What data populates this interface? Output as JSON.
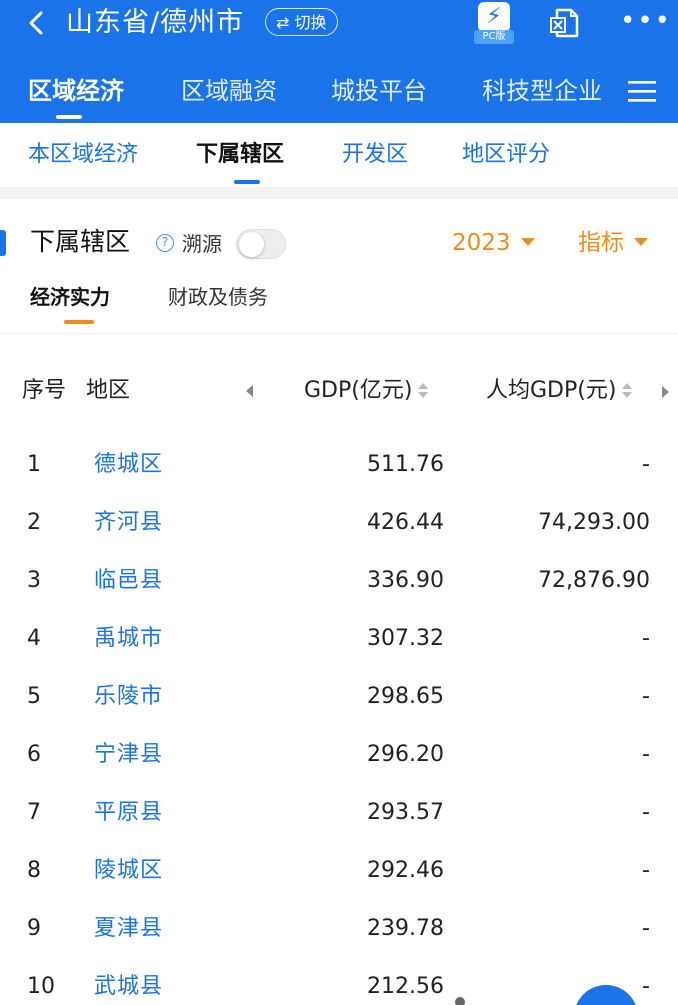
{
  "header": {
    "city": "山东省/德州市",
    "switch_label": "⇄ 切换",
    "pc_label": "PC版",
    "more_label": "•••"
  },
  "main_tabs": [
    "区域经济",
    "区域融资",
    "城投平台",
    "科技型企业"
  ],
  "sub_tabs": [
    "本区域经济",
    "下属辖区",
    "开发区",
    "地区评分"
  ],
  "section": {
    "title": "下属辖区",
    "trace_label": "溯源",
    "trace_enabled": false,
    "year": "2023",
    "metric_label": "指标"
  },
  "category_tabs": [
    "经济实力",
    "财政及债务"
  ],
  "table": {
    "headers": {
      "index": "序号",
      "region": "地区",
      "gdp": "GDP(亿元)",
      "per_capita": "人均GDP(元)"
    },
    "rows": [
      {
        "index": "1",
        "name": "德城区",
        "gdp": "511.76",
        "per_capita": "-"
      },
      {
        "index": "2",
        "name": "齐河县",
        "gdp": "426.44",
        "per_capita": "74,293.00"
      },
      {
        "index": "3",
        "name": "临邑县",
        "gdp": "336.90",
        "per_capita": "72,876.90"
      },
      {
        "index": "4",
        "name": "禹城市",
        "gdp": "307.32",
        "per_capita": "-"
      },
      {
        "index": "5",
        "name": "乐陵市",
        "gdp": "298.65",
        "per_capita": "-"
      },
      {
        "index": "6",
        "name": "宁津县",
        "gdp": "296.20",
        "per_capita": "-"
      },
      {
        "index": "7",
        "name": "平原县",
        "gdp": "293.57",
        "per_capita": "-"
      },
      {
        "index": "8",
        "name": "陵城区",
        "gdp": "292.46",
        "per_capita": "-"
      },
      {
        "index": "9",
        "name": "夏津县",
        "gdp": "239.78",
        "per_capita": "-"
      },
      {
        "index": "10",
        "name": "武城县",
        "gdp": "212.56",
        "per_capita": "-"
      }
    ]
  },
  "colors": {
    "brand": "#1a73e8",
    "accent": "#f08c1a"
  }
}
